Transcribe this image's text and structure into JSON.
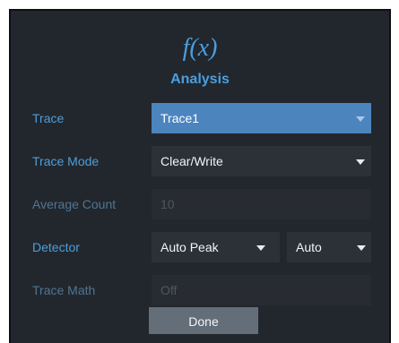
{
  "header": {
    "icon_text": "f(x)",
    "title": "Analysis"
  },
  "rows": {
    "trace": {
      "label": "Trace",
      "value": "Trace1"
    },
    "trace_mode": {
      "label": "Trace Mode",
      "value": "Clear/Write"
    },
    "average_count": {
      "label": "Average Count",
      "value": "10"
    },
    "detector": {
      "label": "Detector",
      "value": "Auto Peak",
      "value2": "Auto"
    },
    "trace_math": {
      "label": "Trace Math",
      "value": "Off"
    }
  },
  "done_label": "Done",
  "colors": {
    "accent": "#4a9ee0",
    "selected_field": "#4c84be",
    "background": "#22272d",
    "button": "#646e79"
  },
  "icons": {
    "function_icon": "function-icon",
    "dropdown_arrow": "chevron-down-icon"
  }
}
